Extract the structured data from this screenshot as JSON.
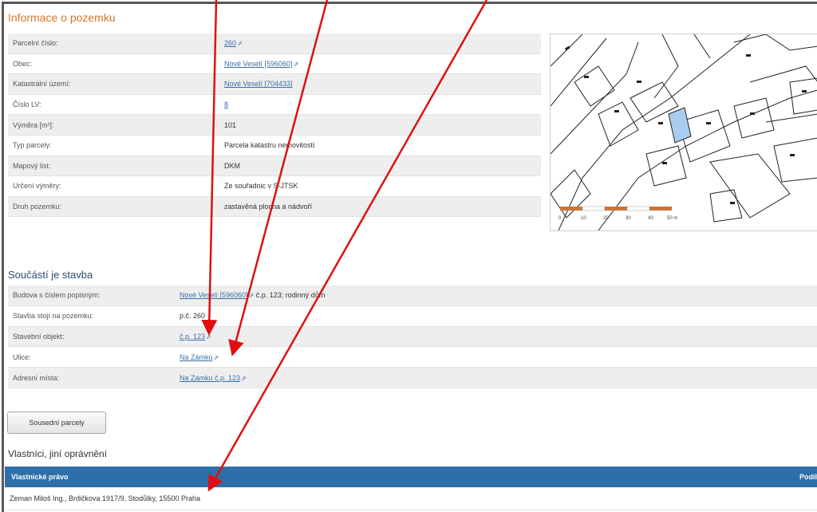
{
  "section_parcel": {
    "title": "Informace o pozemku"
  },
  "parcel": {
    "rows": [
      {
        "label": "Parcelní číslo:",
        "value": "260",
        "link": true
      },
      {
        "label": "Obec:",
        "value": "Nové Veselí [596060]",
        "link": true
      },
      {
        "label": "Katastrální území:",
        "value": "Nové Veselí [704433]",
        "link": true
      },
      {
        "label": "Číslo LV:",
        "value": "8",
        "link": true
      },
      {
        "label": "Výměra [m²]:",
        "value": "101",
        "link": false
      },
      {
        "label": "Typ parcely:",
        "value": "Parcela katastru nemovitostí",
        "link": false
      },
      {
        "label": "Mapový list:",
        "value": "DKM",
        "link": false
      },
      {
        "label": "Určení výměry:",
        "value": "Ze souřadnic v S-JTSK",
        "link": false
      },
      {
        "label": "Druh pozemku:",
        "value": "zastavěná plocha a nádvoří",
        "link": false
      }
    ]
  },
  "section_building": {
    "title": "Součástí je stavba"
  },
  "building": {
    "rows": [
      {
        "label": "Budova s číslem popisným:",
        "link_text": "Nové Veselí [596060]",
        "suffix": " č.p. 123; rodinný dům"
      },
      {
        "label": "Stavba stojí na pozemku:",
        "value": "p.č. 260"
      },
      {
        "label": "Stavební objekt:",
        "link_text": "č.p. 123"
      },
      {
        "label": "Ulice:",
        "link_text": "Na Zámku"
      },
      {
        "label": "Adresní místa:",
        "link_text": "Na Zámku č.p. 123"
      }
    ]
  },
  "buttons": {
    "neighbors": "Sousední parcely"
  },
  "section_owners": {
    "title": "Vlastníci, jiní oprávnění"
  },
  "owners": {
    "header_left": "Vlastnické právo",
    "header_right": "Podíl",
    "row": "Zeman Miloš Ing., Brdičkova 1917/9, Stodůlky, 15500 Praha"
  },
  "map": {
    "scale_labels": [
      "0",
      "10",
      "20",
      "30",
      "40",
      "50 m"
    ]
  },
  "icons": {
    "external_link": "external-link-icon"
  },
  "colors": {
    "accent": "#2f6fa7",
    "title": "#d9772a",
    "link": "#3a6ea5",
    "arrow": "#e01010",
    "highlight_parcel": "#a8cdf0"
  }
}
